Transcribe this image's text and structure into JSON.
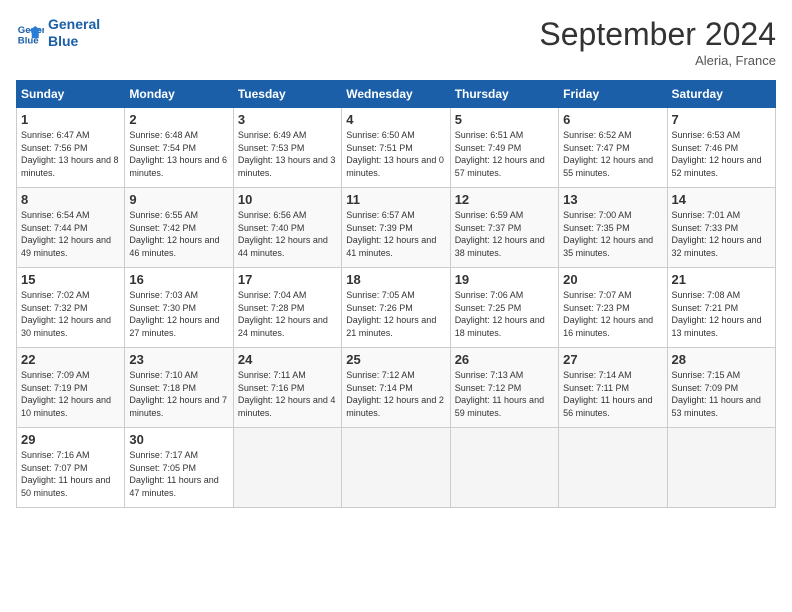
{
  "header": {
    "logo_line1": "General",
    "logo_line2": "Blue",
    "month_title": "September 2024",
    "location": "Aleria, France"
  },
  "columns": [
    "Sunday",
    "Monday",
    "Tuesday",
    "Wednesday",
    "Thursday",
    "Friday",
    "Saturday"
  ],
  "weeks": [
    [
      {
        "num": "1",
        "rise": "6:47 AM",
        "set": "7:56 PM",
        "daylight": "13 hours and 8 minutes."
      },
      {
        "num": "2",
        "rise": "6:48 AM",
        "set": "7:54 PM",
        "daylight": "13 hours and 6 minutes."
      },
      {
        "num": "3",
        "rise": "6:49 AM",
        "set": "7:53 PM",
        "daylight": "13 hours and 3 minutes."
      },
      {
        "num": "4",
        "rise": "6:50 AM",
        "set": "7:51 PM",
        "daylight": "13 hours and 0 minutes."
      },
      {
        "num": "5",
        "rise": "6:51 AM",
        "set": "7:49 PM",
        "daylight": "12 hours and 57 minutes."
      },
      {
        "num": "6",
        "rise": "6:52 AM",
        "set": "7:47 PM",
        "daylight": "12 hours and 55 minutes."
      },
      {
        "num": "7",
        "rise": "6:53 AM",
        "set": "7:46 PM",
        "daylight": "12 hours and 52 minutes."
      }
    ],
    [
      {
        "num": "8",
        "rise": "6:54 AM",
        "set": "7:44 PM",
        "daylight": "12 hours and 49 minutes."
      },
      {
        "num": "9",
        "rise": "6:55 AM",
        "set": "7:42 PM",
        "daylight": "12 hours and 46 minutes."
      },
      {
        "num": "10",
        "rise": "6:56 AM",
        "set": "7:40 PM",
        "daylight": "12 hours and 44 minutes."
      },
      {
        "num": "11",
        "rise": "6:57 AM",
        "set": "7:39 PM",
        "daylight": "12 hours and 41 minutes."
      },
      {
        "num": "12",
        "rise": "6:59 AM",
        "set": "7:37 PM",
        "daylight": "12 hours and 38 minutes."
      },
      {
        "num": "13",
        "rise": "7:00 AM",
        "set": "7:35 PM",
        "daylight": "12 hours and 35 minutes."
      },
      {
        "num": "14",
        "rise": "7:01 AM",
        "set": "7:33 PM",
        "daylight": "12 hours and 32 minutes."
      }
    ],
    [
      {
        "num": "15",
        "rise": "7:02 AM",
        "set": "7:32 PM",
        "daylight": "12 hours and 30 minutes."
      },
      {
        "num": "16",
        "rise": "7:03 AM",
        "set": "7:30 PM",
        "daylight": "12 hours and 27 minutes."
      },
      {
        "num": "17",
        "rise": "7:04 AM",
        "set": "7:28 PM",
        "daylight": "12 hours and 24 minutes."
      },
      {
        "num": "18",
        "rise": "7:05 AM",
        "set": "7:26 PM",
        "daylight": "12 hours and 21 minutes."
      },
      {
        "num": "19",
        "rise": "7:06 AM",
        "set": "7:25 PM",
        "daylight": "12 hours and 18 minutes."
      },
      {
        "num": "20",
        "rise": "7:07 AM",
        "set": "7:23 PM",
        "daylight": "12 hours and 16 minutes."
      },
      {
        "num": "21",
        "rise": "7:08 AM",
        "set": "7:21 PM",
        "daylight": "12 hours and 13 minutes."
      }
    ],
    [
      {
        "num": "22",
        "rise": "7:09 AM",
        "set": "7:19 PM",
        "daylight": "12 hours and 10 minutes."
      },
      {
        "num": "23",
        "rise": "7:10 AM",
        "set": "7:18 PM",
        "daylight": "12 hours and 7 minutes."
      },
      {
        "num": "24",
        "rise": "7:11 AM",
        "set": "7:16 PM",
        "daylight": "12 hours and 4 minutes."
      },
      {
        "num": "25",
        "rise": "7:12 AM",
        "set": "7:14 PM",
        "daylight": "12 hours and 2 minutes."
      },
      {
        "num": "26",
        "rise": "7:13 AM",
        "set": "7:12 PM",
        "daylight": "11 hours and 59 minutes."
      },
      {
        "num": "27",
        "rise": "7:14 AM",
        "set": "7:11 PM",
        "daylight": "11 hours and 56 minutes."
      },
      {
        "num": "28",
        "rise": "7:15 AM",
        "set": "7:09 PM",
        "daylight": "11 hours and 53 minutes."
      }
    ],
    [
      {
        "num": "29",
        "rise": "7:16 AM",
        "set": "7:07 PM",
        "daylight": "11 hours and 50 minutes."
      },
      {
        "num": "30",
        "rise": "7:17 AM",
        "set": "7:05 PM",
        "daylight": "11 hours and 47 minutes."
      },
      null,
      null,
      null,
      null,
      null
    ]
  ],
  "labels": {
    "sunrise": "Sunrise:",
    "sunset": "Sunset:",
    "daylight": "Daylight:"
  }
}
